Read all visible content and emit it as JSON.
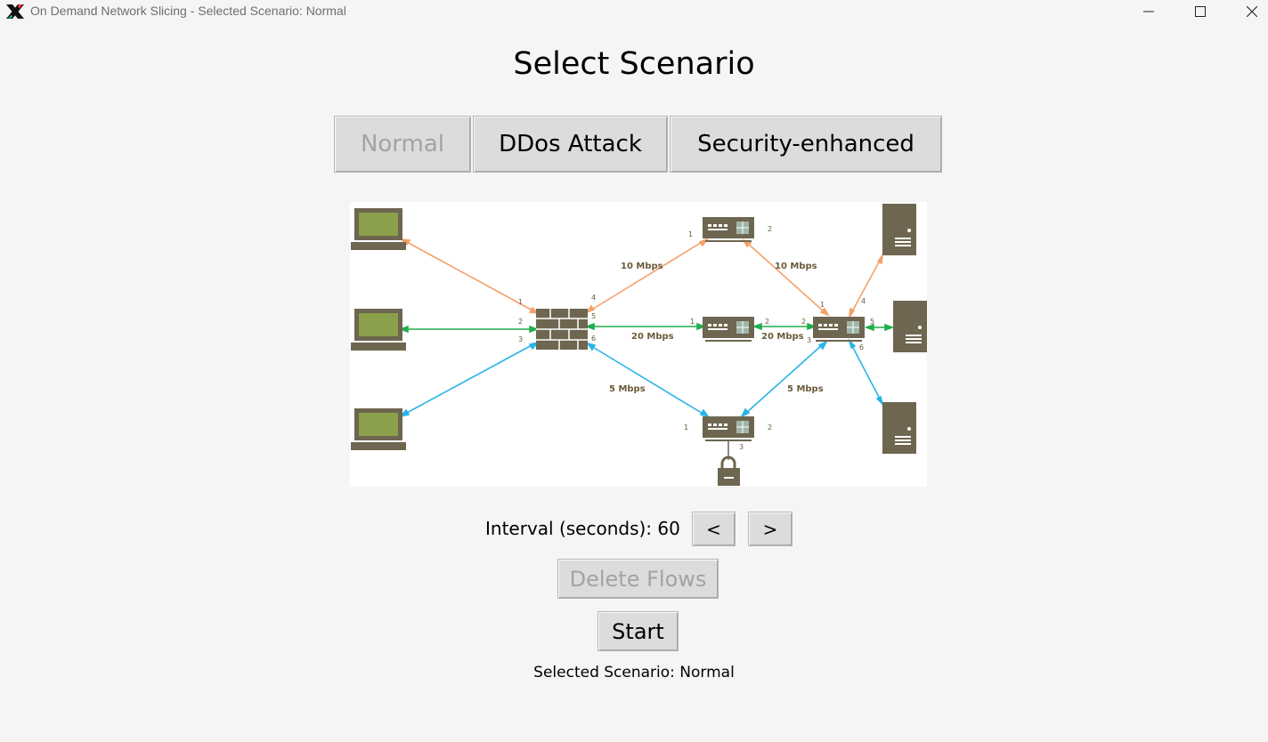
{
  "window": {
    "title": "On Demand Network Slicing - Selected Scenario: Normal",
    "app_icon": "x-logo-icon"
  },
  "heading": "Select Scenario",
  "scenarios": [
    {
      "label": "Normal",
      "enabled": false
    },
    {
      "label": "DDos Attack",
      "enabled": true
    },
    {
      "label": "Security-enhanced",
      "enabled": true
    }
  ],
  "diagram": {
    "links": {
      "top_left": "10 Mbps",
      "top_right": "10 Mbps",
      "mid_left": "20 Mbps",
      "mid_right": "20 Mbps",
      "bottom_left": "5 Mbps",
      "bottom_right": "5 Mbps"
    },
    "ports": {
      "fw_in_1": "1",
      "fw_in_2": "2",
      "fw_in_3": "3",
      "fw_out_4": "4",
      "fw_out_5": "5",
      "fw_out_6": "6",
      "sw_top_1": "1",
      "sw_top_2": "2",
      "sw_mid_1": "1",
      "sw_mid_2": "2",
      "sw_bot_1": "1",
      "sw_bot_2": "2",
      "sw_bot_3": "3",
      "core_1": "1",
      "core_2": "2",
      "core_3": "3",
      "core_4": "4",
      "core_5": "5",
      "core_6": "6"
    },
    "colors": {
      "orange": "#f4a06a",
      "green": "#1fae4c",
      "blue": "#29b4e6",
      "device": "#6e6650",
      "screen": "#8aa04a"
    }
  },
  "interval": {
    "label": "Interval (seconds): 60",
    "decrease": "<",
    "increase": ">"
  },
  "delete_flows": {
    "label": "Delete Flows",
    "enabled": false
  },
  "start": {
    "label": "Start"
  },
  "status_text": "Selected Scenario: Normal"
}
